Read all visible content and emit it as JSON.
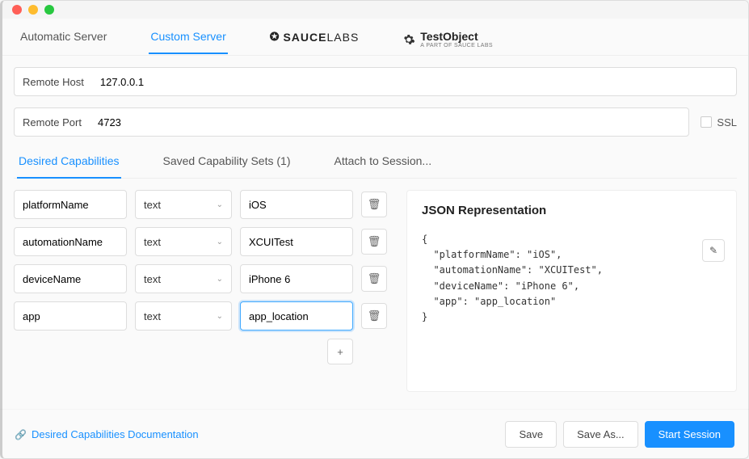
{
  "serverTabs": {
    "automatic": "Automatic Server",
    "custom": "Custom Server",
    "sauce": "SAUCE",
    "labs": "LABS",
    "testobject": "TestObject",
    "testobject_sub": "A PART OF SAUCE LABS"
  },
  "remote": {
    "host_label": "Remote Host",
    "host_value": "127.0.0.1",
    "port_label": "Remote Port",
    "port_value": "4723",
    "ssl_label": "SSL"
  },
  "capTabs": {
    "desired": "Desired Capabilities",
    "saved": "Saved Capability Sets (1)",
    "attach": "Attach to Session..."
  },
  "caps": [
    {
      "name": "platformName",
      "type": "text",
      "value": "iOS",
      "focused": false
    },
    {
      "name": "automationName",
      "type": "text",
      "value": "XCUITest",
      "focused": false
    },
    {
      "name": "deviceName",
      "type": "text",
      "value": "iPhone 6",
      "focused": false
    },
    {
      "name": "app",
      "type": "text",
      "value": "app_location",
      "focused": true
    }
  ],
  "json": {
    "title": "JSON Representation",
    "body": "{\n  \"platformName\": \"iOS\",\n  \"automationName\": \"XCUITest\",\n  \"deviceName\": \"iPhone 6\",\n  \"app\": \"app_location\"\n}"
  },
  "footer": {
    "docs": "Desired Capabilities Documentation",
    "save": "Save",
    "save_as": "Save As...",
    "start": "Start Session"
  },
  "icons": {
    "plus": "+",
    "trash": "🗑",
    "chevron": "⌄",
    "edit": "✎",
    "link": "🔗"
  }
}
